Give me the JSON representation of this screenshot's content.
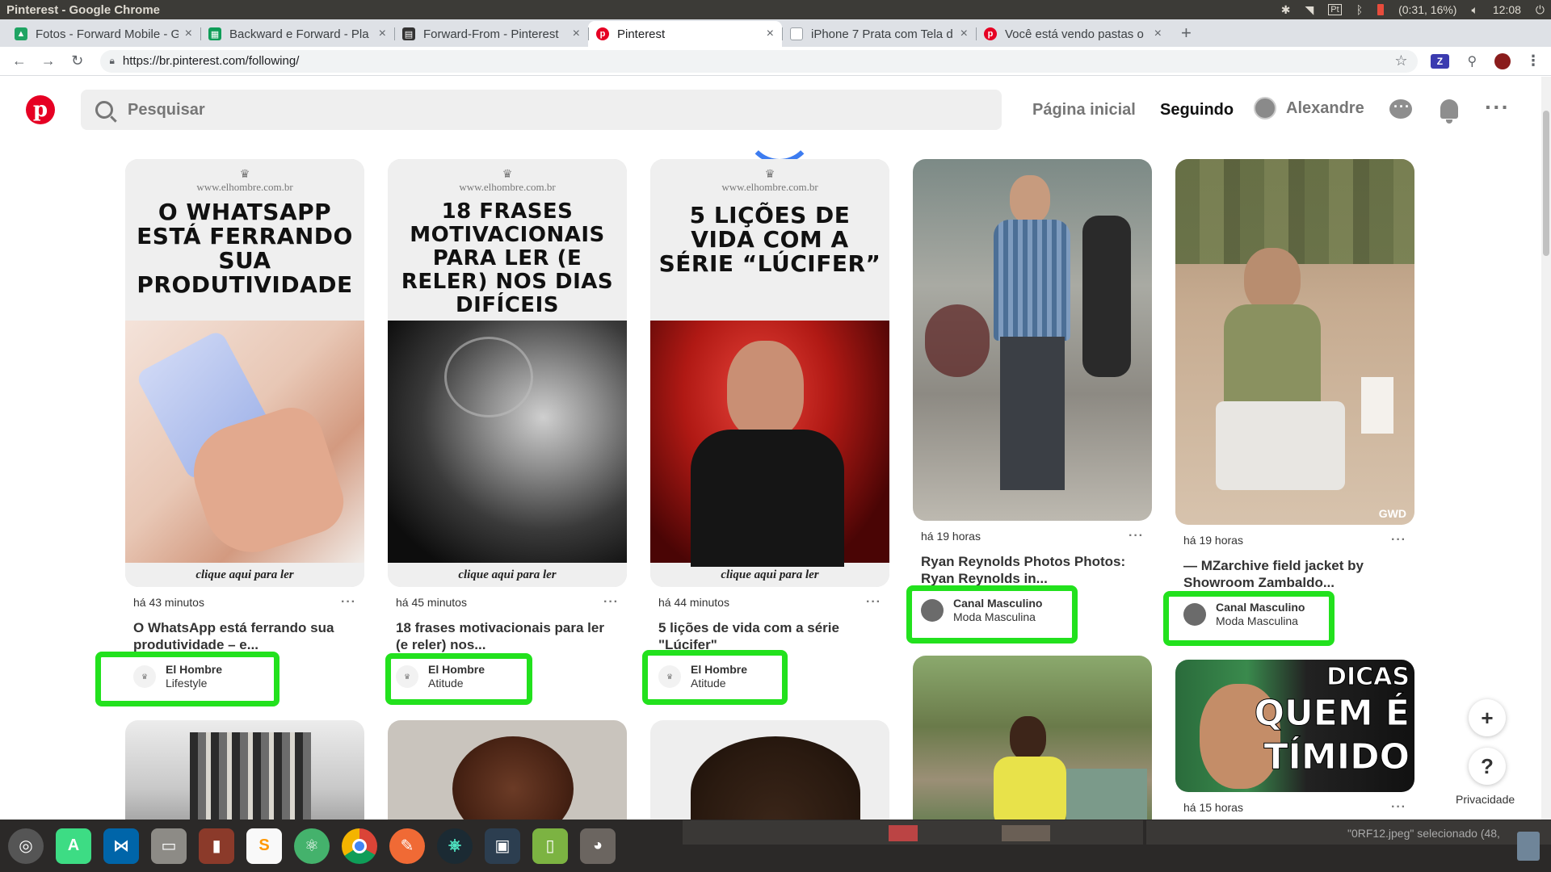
{
  "os": {
    "window_title": "Pinterest - Google Chrome",
    "battery": "(0:31, 16%)",
    "clock": "12:08"
  },
  "tabs": [
    {
      "label": "Fotos - Forward Mobile - G",
      "icon": "google-drive-icon",
      "color": "#1fa463"
    },
    {
      "label": "Backward e Forward - Pla",
      "icon": "google-sheets-icon",
      "color": "#0f9d58"
    },
    {
      "label": "Forward-From - Pinterest",
      "icon": "document-icon",
      "color": "#333333"
    },
    {
      "label": "Pinterest",
      "icon": "pinterest-icon",
      "color": "#e60023"
    },
    {
      "label": "iPhone 7 Prata com Tela d",
      "icon": "page-icon",
      "color": "#9aa0a6"
    },
    {
      "label": "Você está vendo pastas o",
      "icon": "pinterest-icon",
      "color": "#e60023"
    }
  ],
  "toolbar": {
    "url": "https://br.pinterest.com/following/"
  },
  "header": {
    "search_placeholder": "Pesquisar",
    "home": "Página inicial",
    "following": "Seguindo",
    "user": "Alexandre"
  },
  "pins": [
    {
      "time": "há 43 minutos",
      "title": "O WhatsApp está ferrando sua produtividade – e...",
      "source": "El Hombre",
      "board": "Lifestyle",
      "card_url": "www.elhombre.com.br",
      "card_headline": "O WHATSAPP ESTÁ FERRANDO SUA PRODUTIVIDADE",
      "card_cta": "clique aqui para ler"
    },
    {
      "time": "há 45 minutos",
      "title": "18 frases motivacionais para ler (e reler) nos...",
      "source": "El Hombre",
      "board": "Atitude",
      "card_url": "www.elhombre.com.br",
      "card_headline": "18 FRASES MOTIVACIONAIS PARA LER (E RELER) NOS DIAS DIFÍCEIS",
      "card_cta": "clique aqui para ler"
    },
    {
      "time": "há 44 minutos",
      "title": "5 lições de vida com a série \"Lúcifer\"",
      "source": "El Hombre",
      "board": "Atitude",
      "card_url": "www.elhombre.com.br",
      "card_headline": "5 LIÇÕES DE VIDA COM A SÉRIE “LÚCIFER”",
      "card_cta": "clique aqui para ler"
    },
    {
      "time": "há 19 horas",
      "title": "Ryan Reynolds Photos Photos: Ryan Reynolds in...",
      "source": "Canal Masculino",
      "board": "Moda Masculina"
    },
    {
      "time": "há 19 horas",
      "title": "— MZarchive field jacket by Showroom Zambaldo...",
      "source": "Canal Masculino",
      "board": "Moda Masculina",
      "watermark": "GWD"
    },
    {
      "time": "há 15 horas",
      "card_text": [
        "DICAS",
        "QUEM É",
        "TÍMIDO"
      ]
    }
  ],
  "floating": {
    "add": "+",
    "help": "?",
    "privacy": "Privacidade"
  },
  "taskbar": {
    "status": "\"0RF12.jpeg\" selecionado (48,"
  }
}
